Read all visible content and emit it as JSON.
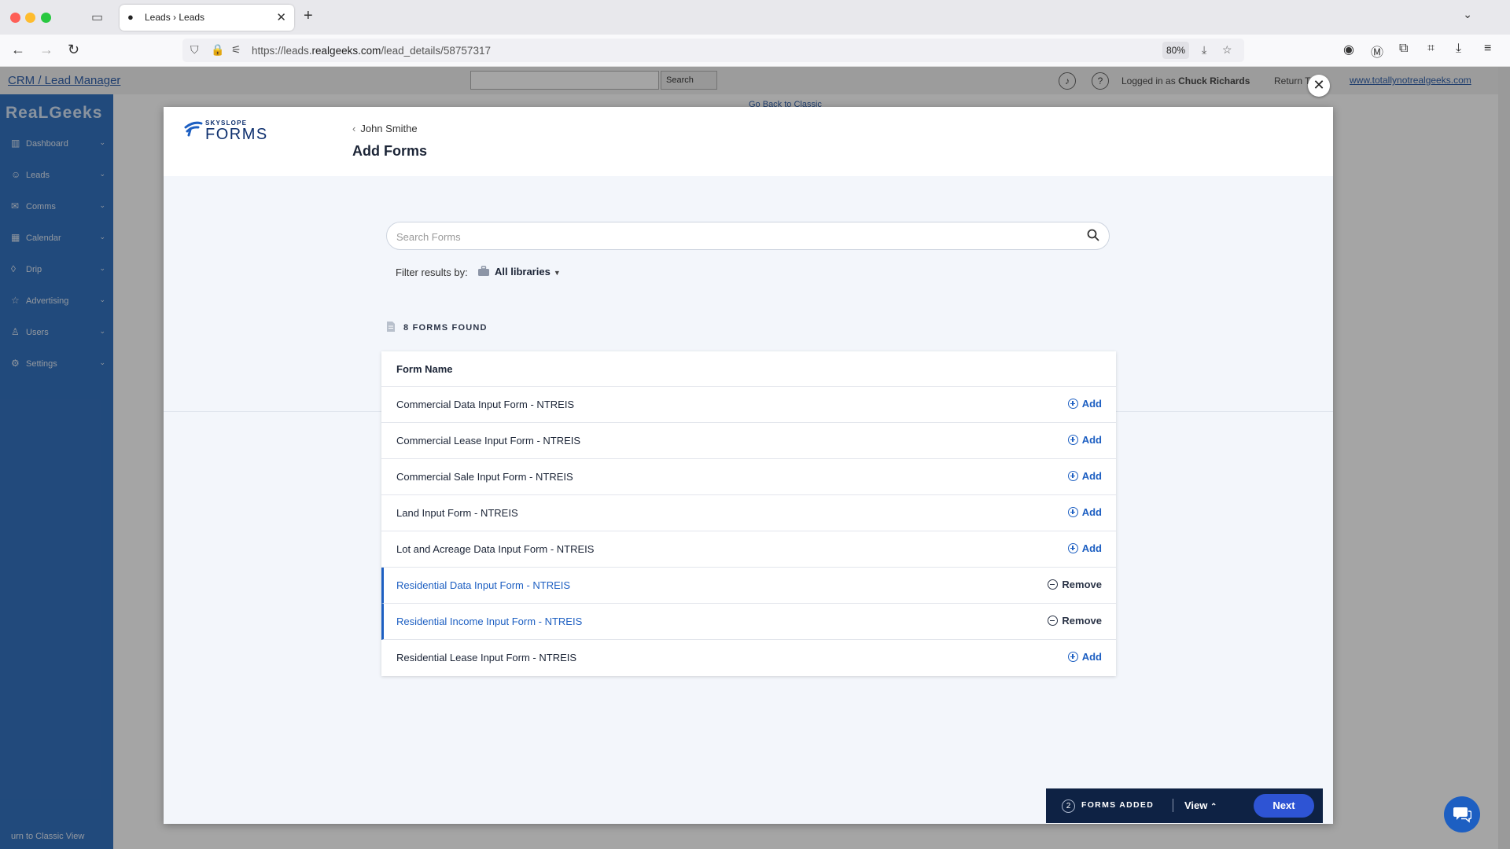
{
  "browser": {
    "tab_title": "Leads › Leads",
    "url_prefix": "https://leads.",
    "url_domain": "realgeeks.com",
    "url_path": "/lead_details/58757317",
    "zoom": "80%"
  },
  "crm": {
    "title": "CRM / Lead Manager",
    "search_button": "Search",
    "logged_in_prefix": "Logged in as",
    "user_name": "Chuck Richards",
    "return_text": "Return To",
    "site_link": "www.totallynotrealgeeks.com",
    "go_back": "Go Back to Classic",
    "logo": "ReaLGeeks",
    "sidebar": [
      {
        "label": "Dashboard",
        "icon": "chart-icon"
      },
      {
        "label": "Leads",
        "icon": "users-icon"
      },
      {
        "label": "Comms",
        "icon": "mail-icon"
      },
      {
        "label": "Calendar",
        "icon": "calendar-icon"
      },
      {
        "label": "Drip",
        "icon": "drop-icon"
      },
      {
        "label": "Advertising",
        "icon": "star-icon"
      },
      {
        "label": "Users",
        "icon": "user-icon"
      },
      {
        "label": "Settings",
        "icon": "gear-icon"
      }
    ],
    "sidebar_bottom": "urn to Classic View"
  },
  "modal": {
    "brand_small": "SKYSLOPE",
    "brand_large": "FORMS",
    "back_label": "John Smithe",
    "title": "Add Forms",
    "search_placeholder": "Search Forms",
    "filter_label": "Filter results by:",
    "filter_value": "All libraries",
    "found_label": "8 FORMS FOUND",
    "table_header": "Form Name",
    "rows": [
      {
        "name": "Commercial Data Input Form - NTREIS",
        "action": "Add",
        "selected": false
      },
      {
        "name": "Commercial Lease Input Form - NTREIS",
        "action": "Add",
        "selected": false
      },
      {
        "name": "Commercial Sale Input Form - NTREIS",
        "action": "Add",
        "selected": false
      },
      {
        "name": "Land Input Form - NTREIS",
        "action": "Add",
        "selected": false
      },
      {
        "name": "Lot and Acreage Data Input Form - NTREIS",
        "action": "Add",
        "selected": false
      },
      {
        "name": "Residential Data Input Form - NTREIS",
        "action": "Remove",
        "selected": true
      },
      {
        "name": "Residential Income Input Form - NTREIS",
        "action": "Remove",
        "selected": true
      },
      {
        "name": "Residential Lease Input Form - NTREIS",
        "action": "Add",
        "selected": false
      }
    ],
    "forms_added_count": "2",
    "forms_added_label": "FORMS ADDED",
    "view_label": "View",
    "next_label": "Next"
  },
  "colors": {
    "accent": "#1d5fc2",
    "navy": "#0e2244",
    "sidebar": "#1d63b8",
    "next_button": "#2e54d4"
  }
}
